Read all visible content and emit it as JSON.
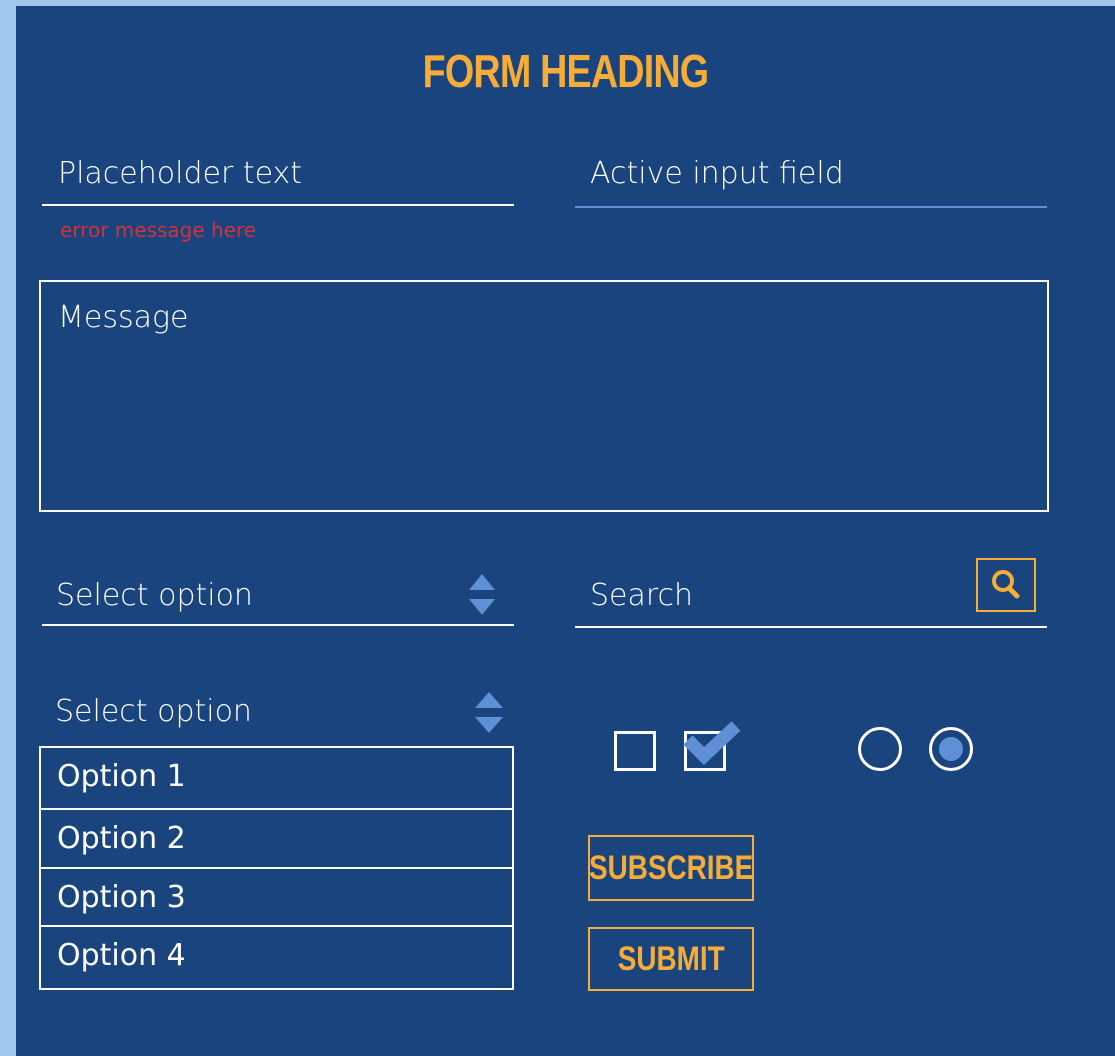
{
  "form": {
    "heading": "FORM HEADING",
    "name_input": {
      "placeholder": "Placeholder text",
      "error": "error message here"
    },
    "active_input": {
      "value": "Active input field"
    },
    "message": {
      "placeholder": "Message"
    },
    "select_closed": {
      "label": "Select option"
    },
    "search": {
      "placeholder": "Search",
      "icon": "search-icon"
    },
    "select_open": {
      "label": "Select option",
      "options": [
        "Option 1",
        "Option 2",
        "Option 3",
        "Option 4"
      ]
    },
    "subscribe_label": "SUBSCRIBE",
    "submit_label": "SUBMIT"
  },
  "colors": {
    "page_bg": "#9fc7ea",
    "panel_bg": "#19447e",
    "accent": "#f6ad38",
    "active_line": "#5f8fd5",
    "error": "#d0323a"
  }
}
